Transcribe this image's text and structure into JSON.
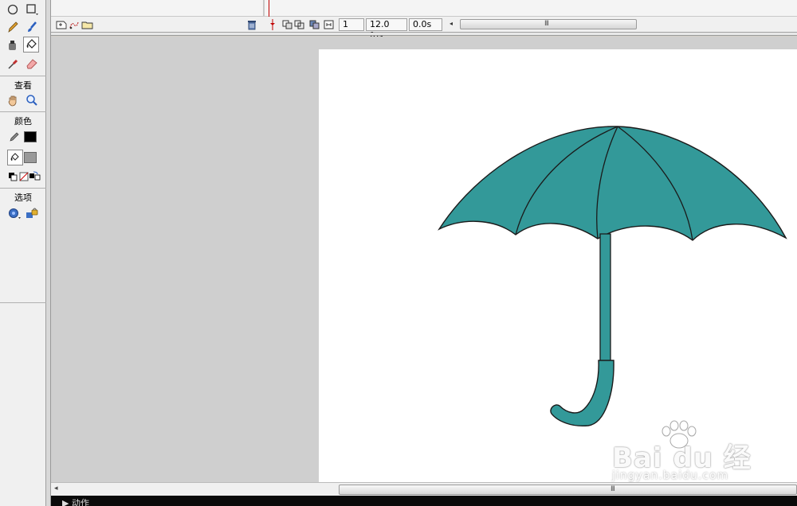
{
  "toolbox": {
    "tools_top": [
      "oval-tool",
      "rectangle-tool",
      "pencil-tool",
      "brush-tool",
      "ink-bottle-tool",
      "paint-bucket-tool",
      "eyedropper-tool",
      "eraser-tool"
    ],
    "view_label": "查看",
    "view_tools": [
      "hand-tool",
      "zoom-tool"
    ],
    "colors_label": "颜色",
    "stroke_color": "#000000",
    "fill_color": "#999999",
    "options_label": "选项"
  },
  "timeline": {
    "frame_number": "1",
    "frame_rate": "12.0 fps",
    "elapsed_time": "0.0s",
    "scroll_grip": "III"
  },
  "stage": {
    "umbrella_fill": "#339999",
    "outline_color": "#1a1a1a"
  },
  "watermark": {
    "brand": "Bai du 经验",
    "url": "jingyan.baidu.com"
  },
  "bottom_scroll": {
    "grip": "III"
  },
  "actions_panel": {
    "label": "▶ 动作"
  }
}
